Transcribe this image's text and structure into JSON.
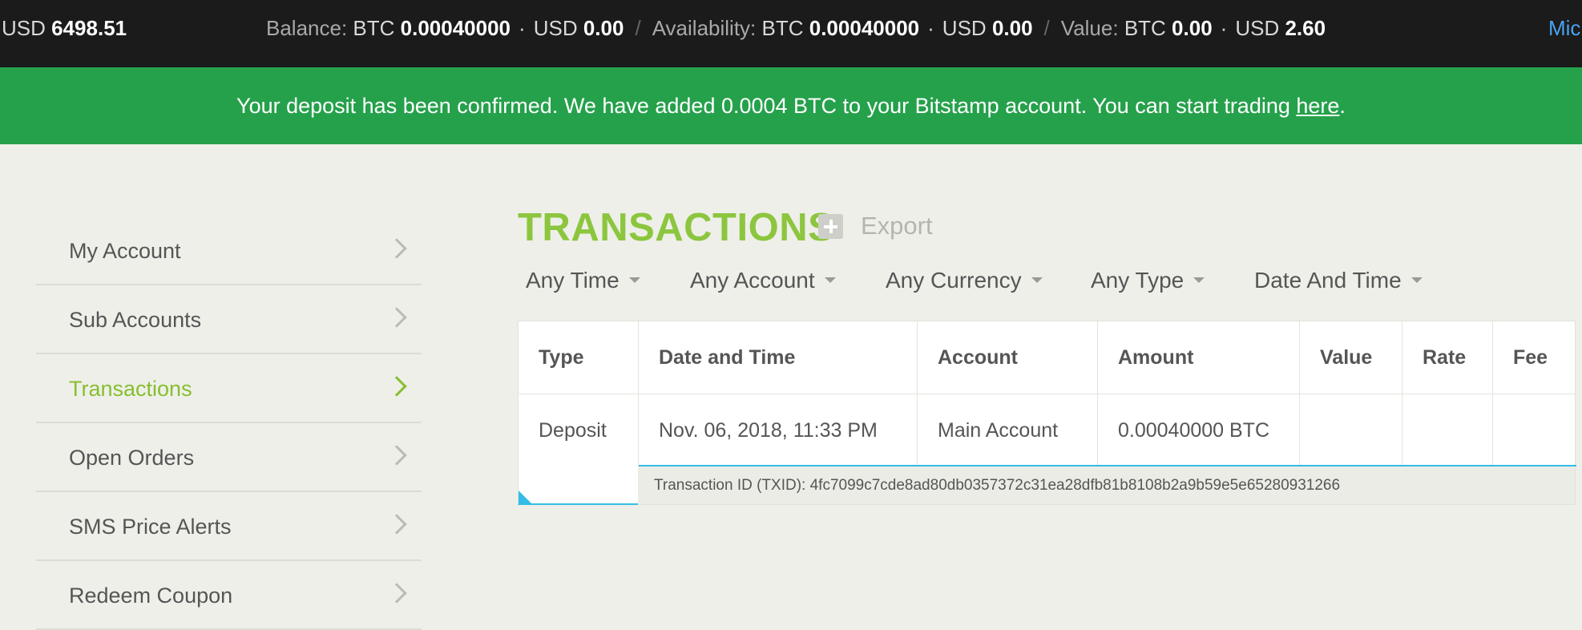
{
  "topbar": {
    "price_currency": "USD",
    "price_value": "6498.51",
    "balance_label": "Balance:",
    "balance_btc_cur": "BTC",
    "balance_btc": "0.00040000",
    "balance_usd_cur": "USD",
    "balance_usd": "0.00",
    "availability_label": "Availability:",
    "availability_btc_cur": "BTC",
    "availability_btc": "0.00040000",
    "availability_usd_cur": "USD",
    "availability_usd": "0.00",
    "value_label": "Value:",
    "value_btc_cur": "BTC",
    "value_btc": "0.00",
    "value_usd_cur": "USD",
    "value_usd": "2.60",
    "dot": "·",
    "separator": "/",
    "user_truncated": "Mic"
  },
  "notice": {
    "text": "Your deposit has been confirmed. We have added 0.0004 BTC to your Bitstamp account. You can start trading ",
    "link": "here",
    "end": "."
  },
  "sidebar": {
    "items": [
      {
        "label": "My Account"
      },
      {
        "label": "Sub Accounts"
      },
      {
        "label": "Transactions"
      },
      {
        "label": "Open Orders"
      },
      {
        "label": "SMS Price Alerts"
      },
      {
        "label": "Redeem Coupon"
      }
    ],
    "active_index": 2
  },
  "main": {
    "title": "TRANSACTIONS",
    "export_label": "Export",
    "filters": [
      "Any Time",
      "Any Account",
      "Any Currency",
      "Any Type",
      "Date And Time"
    ]
  },
  "table": {
    "headers": [
      "Type",
      "Date and Time",
      "Account",
      "Amount",
      "Value",
      "Rate",
      "Fee"
    ],
    "rows": [
      {
        "type": "Deposit",
        "datetime": "Nov. 06, 2018, 11:33 PM",
        "account": "Main Account",
        "amount": "0.00040000 BTC",
        "value": "",
        "rate": "",
        "fee": "",
        "txid_label": "Transaction ID (TXID): 4fc7099c7cde8ad80db0357372c31ea28dfb81b8108b2a9b59e5e65280931266"
      }
    ]
  },
  "colors": {
    "topbar_bg": "#1b1b1b",
    "notice_bg": "#25a14b",
    "accent_green": "#8cc63f",
    "link_blue": "#4aa3f0",
    "row_highlight": "#33bde6"
  },
  "icons": {
    "sidebar_chevron": "chevron-right-icon",
    "export": "plus-square-icon",
    "filter_caret": "caret-down-icon"
  }
}
